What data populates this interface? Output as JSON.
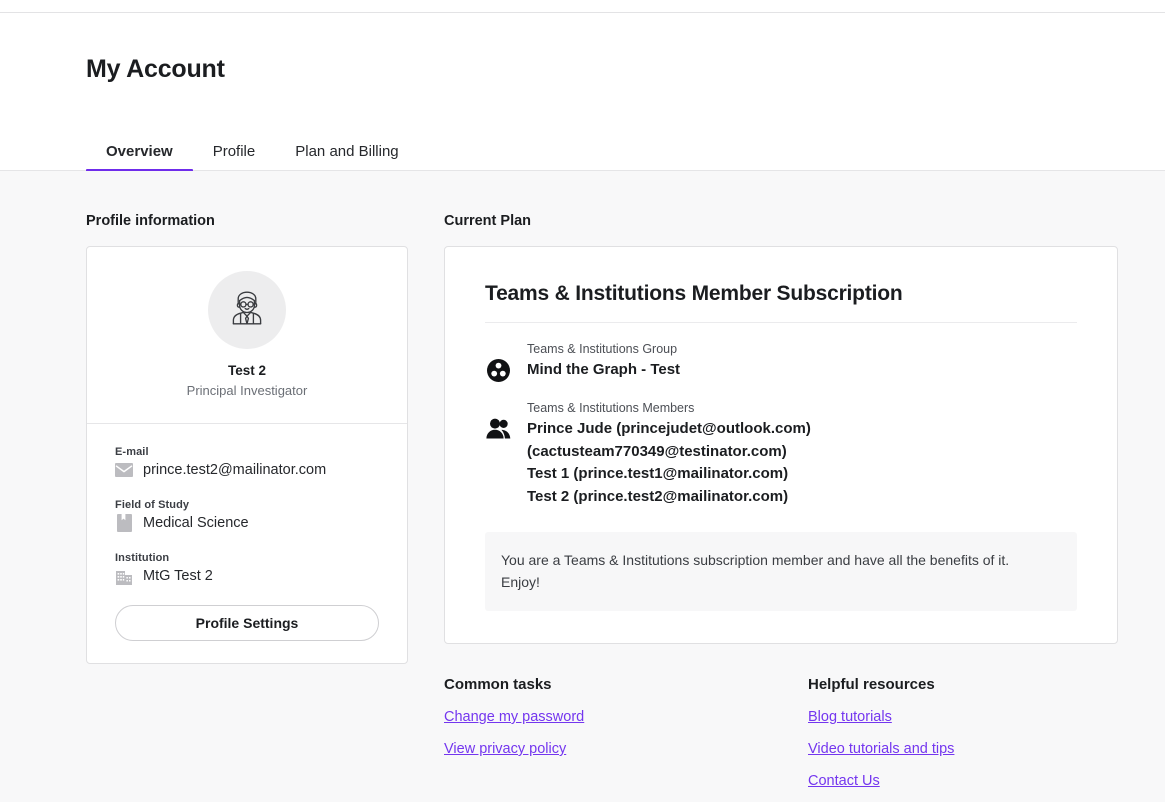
{
  "header": {
    "title": "My Account",
    "tabs": [
      {
        "label": "Overview",
        "active": true
      },
      {
        "label": "Profile",
        "active": false
      },
      {
        "label": "Plan and Billing",
        "active": false
      }
    ]
  },
  "profile_section": {
    "label": "Profile information",
    "avatar_icon": "scientist-avatar-icon",
    "name": "Test 2",
    "role": "Principal Investigator",
    "details": [
      {
        "label": "E-mail",
        "value": "prince.test2@mailinator.com",
        "icon": "envelope-icon"
      },
      {
        "label": "Field of Study",
        "value": "Medical Science",
        "icon": "book-icon"
      },
      {
        "label": "Institution",
        "value": "MtG Test 2",
        "icon": "building-icon"
      }
    ],
    "settings_button": "Profile Settings"
  },
  "plan_section": {
    "label": "Current Plan",
    "title": "Teams & Institutions Member Subscription",
    "group": {
      "label": "Teams & Institutions Group",
      "value": "Mind the Graph - Test",
      "icon": "group-circle-icon"
    },
    "members": {
      "label": "Teams & Institutions Members",
      "icon": "people-icon",
      "list": [
        "Prince Jude (princejudet@outlook.com)",
        "(cactusteam770349@testinator.com)",
        "Test 1 (prince.test1@mailinator.com)",
        "Test 2 (prince.test2@mailinator.com)"
      ]
    },
    "note": "You are a Teams & Institutions subscription member and have all the benefits of it. Enjoy!"
  },
  "common_tasks": {
    "heading": "Common tasks",
    "links": [
      "Change my password",
      "View privacy policy"
    ]
  },
  "helpful_resources": {
    "heading": "Helpful resources",
    "links": [
      "Blog tutorials",
      "Video tutorials and tips",
      "Contact Us"
    ]
  },
  "colors": {
    "accent": "#6f2ceb",
    "link": "#7436ef",
    "page_bg": "#f8f8f9",
    "card_bg": "#ffffff",
    "border": "#e0e0e2"
  }
}
